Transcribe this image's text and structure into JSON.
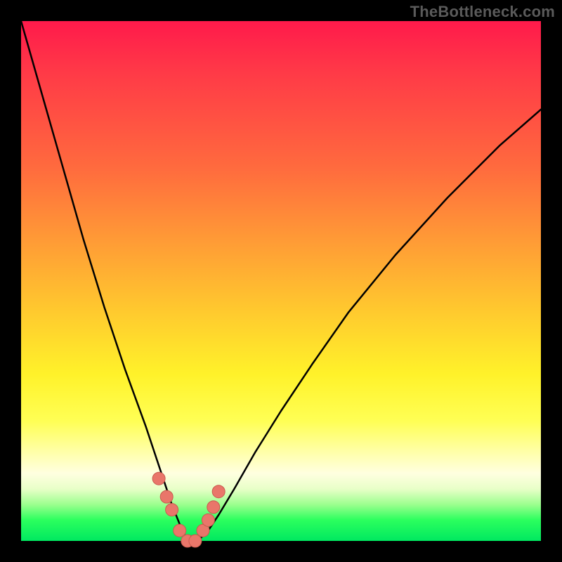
{
  "watermark": "TheBottleneck.com",
  "colors": {
    "frame": "#000000",
    "curve": "#000000",
    "marker_fill": "#e9766a",
    "marker_stroke": "#c95a4e"
  },
  "chart_data": {
    "type": "line",
    "title": "",
    "xlabel": "",
    "ylabel": "",
    "xlim": [
      0,
      100
    ],
    "ylim": [
      0,
      100
    ],
    "note": "Axes implied only by color gradient; no tick labels shown. Y≈100 at top (red / high bottleneck), Y≈0 at bottom (green / balanced). V-shaped bottleneck curve with minimum near x≈32.",
    "series": [
      {
        "name": "bottleneck-curve",
        "x": [
          0,
          4,
          8,
          12,
          16,
          20,
          24,
          27,
          29,
          31,
          32,
          34,
          36,
          38,
          41,
          45,
          50,
          56,
          63,
          72,
          82,
          92,
          100
        ],
        "y": [
          100,
          86,
          72,
          58,
          45,
          33,
          22,
          13,
          7,
          2,
          0,
          0,
          2,
          5,
          10,
          17,
          25,
          34,
          44,
          55,
          66,
          76,
          83
        ]
      }
    ],
    "markers": {
      "name": "highlighted-points",
      "x": [
        26.5,
        28.0,
        29.0,
        30.5,
        32.0,
        33.5,
        35.0,
        36.0,
        37.0,
        38.0
      ],
      "y": [
        12.0,
        8.5,
        6.0,
        2.0,
        0.0,
        0.0,
        2.0,
        4.0,
        6.5,
        9.5
      ]
    }
  }
}
